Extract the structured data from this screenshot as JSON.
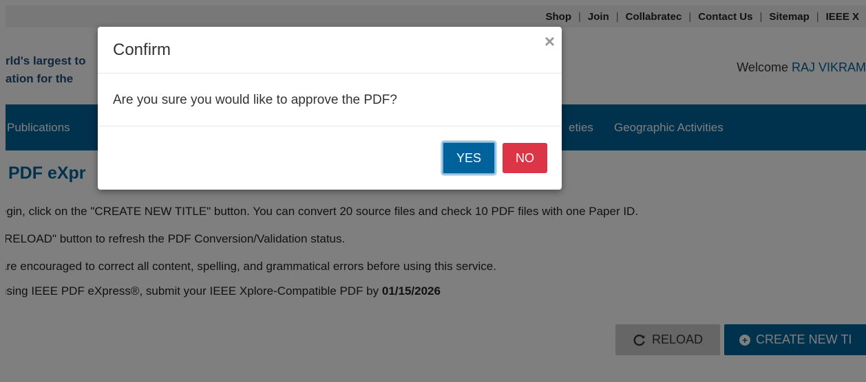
{
  "topbar": {
    "links": [
      "Shop",
      "Join",
      "Collabratec",
      "Contact Us",
      "Sitemap",
      "IEEE X"
    ]
  },
  "header": {
    "tagline_line1": "rld's largest to",
    "tagline_line2": "ation for the",
    "welcome_prefix": "Welcome ",
    "user_name": "RAJ VIKRAM"
  },
  "nav": {
    "items": [
      "Publications",
      "eties",
      "Geographic Activities"
    ]
  },
  "main": {
    "title": "PDF eXpr",
    "instructions": [
      "egin, click on the \"CREATE NEW TITLE\" button. You can convert 20 source files and check 10 PDF files with one Paper ID.",
      "\"RELOAD\" button to refresh the PDF Conversion/Validation status.",
      "are encouraged to correct all content, spelling, and grammatical errors before using this service."
    ],
    "deadline_prefix": "using IEEE PDF eXpress®, submit your IEEE Xplore-Compatible PDF by ",
    "deadline_date": "01/15/2026",
    "reload_label": "RELOAD",
    "create_label": "CREATE NEW TI"
  },
  "modal": {
    "title": "Confirm",
    "close_glyph": "×",
    "message": "Are you sure you would like to approve the PDF?",
    "yes_label": "YES",
    "no_label": "NO"
  },
  "colors": {
    "brand_blue": "#00629b",
    "danger_red": "#dc3545",
    "overlay": "rgba(0,0,0,0.5)"
  }
}
